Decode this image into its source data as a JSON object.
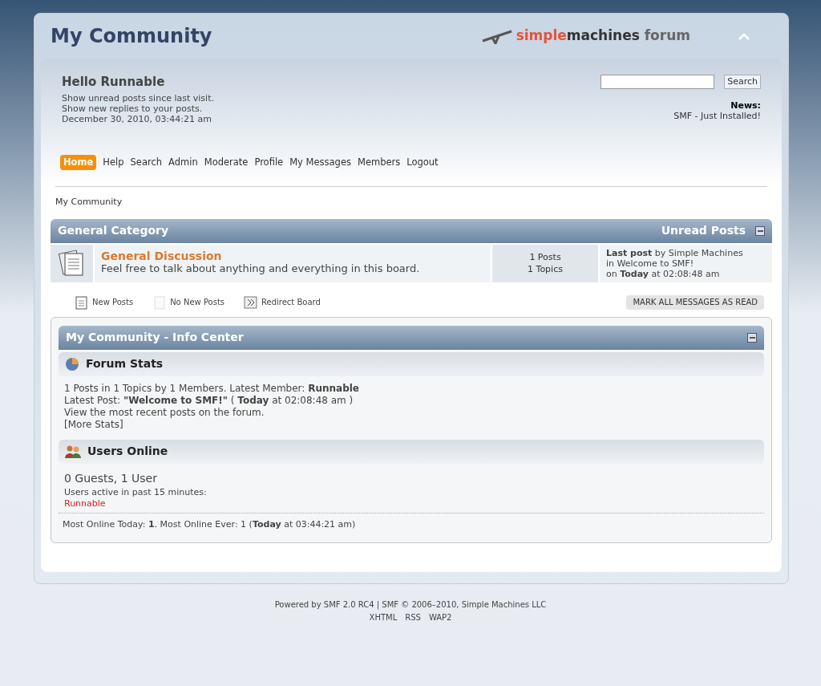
{
  "header": {
    "title": "My Community",
    "logo_parts": [
      "simple",
      "machines",
      "forum"
    ]
  },
  "user": {
    "greeting": "Hello Runnable",
    "links": [
      "Show unread posts since last visit.",
      "Show new replies to your posts."
    ],
    "date": "December 30, 2010, 03:44:21 am"
  },
  "search": {
    "button": "Search"
  },
  "news": {
    "label": "News:",
    "text": "SMF - Just Installed!"
  },
  "menu": [
    {
      "label": "Home",
      "selected": true
    },
    {
      "label": "Help",
      "selected": false
    },
    {
      "label": "Search",
      "selected": false
    },
    {
      "label": "Admin",
      "selected": false
    },
    {
      "label": "Moderate",
      "selected": false
    },
    {
      "label": "Profile",
      "selected": false
    },
    {
      "label": "My Messages",
      "selected": false
    },
    {
      "label": "Members",
      "selected": false
    },
    {
      "label": "Logout",
      "selected": false
    }
  ],
  "breadcrumb": "My Community",
  "category": {
    "title": "General Category",
    "unread": "Unread Posts",
    "boards": [
      {
        "name": "General Discussion",
        "description": "Feel free to talk about anything and everything in this board.",
        "posts": "1 Posts",
        "topics": "1 Topics",
        "last_post": [
          "**Last post** by Simple Machines",
          "in Welcome to SMF!",
          "on **Today** at 02:08:48 am"
        ]
      }
    ]
  },
  "legend": [
    {
      "kind": "new",
      "label": "New Posts"
    },
    {
      "kind": "none",
      "label": "No New Posts"
    },
    {
      "kind": "redirect",
      "label": "Redirect Board"
    }
  ],
  "mark_read": "MARK ALL MESSAGES AS READ",
  "info_center": {
    "title": "My Community - Info Center",
    "stats": {
      "title": "Forum Stats",
      "lines": [
        "1 Posts in 1 Topics by 1 Members. Latest Member: **Runnable**",
        "Latest Post: **\"Welcome to SMF!\"** ( **Today** at 02:08:48 am )",
        "View the most recent posts on the forum.",
        "[More Stats]"
      ]
    },
    "online": {
      "title": "Users Online",
      "count": "0 Guests, 1 User",
      "active_label": "Users active in past 15 minutes:",
      "users": [
        "Runnable"
      ],
      "most": "Most Online Today: **1**. Most Online Ever: 1 (**Today** at 03:44:21 am)"
    }
  },
  "footer": {
    "line": "Powered by SMF 2.0 RC4 | SMF © 2006–2010, Simple Machines LLC",
    "links": [
      "XHTML",
      "RSS",
      "WAP2"
    ]
  }
}
